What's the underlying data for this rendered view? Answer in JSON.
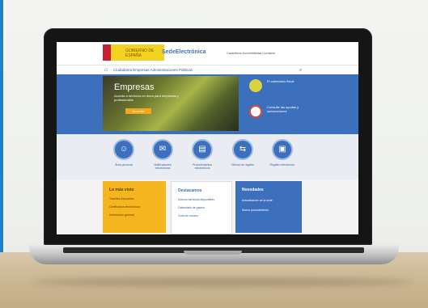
{
  "scene": {
    "description": "Laptop on a wooden desk showing a Spanish government portal",
    "colors": {
      "accent_blue": "#3c6fbc",
      "accent_yellow": "#f5b51f",
      "frame_blue": "#1f7fc9"
    }
  },
  "site": {
    "logo_text": "GOBIERNO DE ESPAÑA",
    "portal_name": "SedeElectrónica",
    "top_links": "Castellano   Accesibilidad   Contacto",
    "nav": {
      "home_icon": "home-icon",
      "items": "Ciudadanía   Empresas   Administraciones Públicas"
    },
    "hero": {
      "title": "Empresas",
      "subtitle": "Acceda a servicios en línea para empresas y profesionales",
      "button": "Acceder",
      "side_cards": [
        {
          "text": "El calendario fiscal",
          "color": "#d9d340"
        },
        {
          "text": "Consulte las ayudas y subvenciones",
          "color": "#ffffff"
        }
      ]
    },
    "services": [
      {
        "label": "Área personal",
        "icon": "user-icon"
      },
      {
        "label": "Notificaciones electrónicas",
        "icon": "mail-icon"
      },
      {
        "label": "Procedimientos electrónicos",
        "icon": "document-icon"
      },
      {
        "label": "Oficina de registro",
        "icon": "arrow-icon"
      },
      {
        "label": "Registro electrónico",
        "icon": "folder-icon"
      }
    ],
    "panels": {
      "yellow": {
        "title": "Lo más visto",
        "items": [
          "Trámites frecuentes",
          "Certificados electrónicos",
          "Información general"
        ]
      },
      "white": {
        "title": "Destacamos",
        "items": [
          "Nuevos servicios disponibles",
          "Calendario de plazos",
          "Guía de usuario"
        ]
      },
      "blue": {
        "title": "Novedades",
        "items": [
          "Actualización de la sede",
          "Nuevo procedimiento"
        ]
      }
    }
  }
}
